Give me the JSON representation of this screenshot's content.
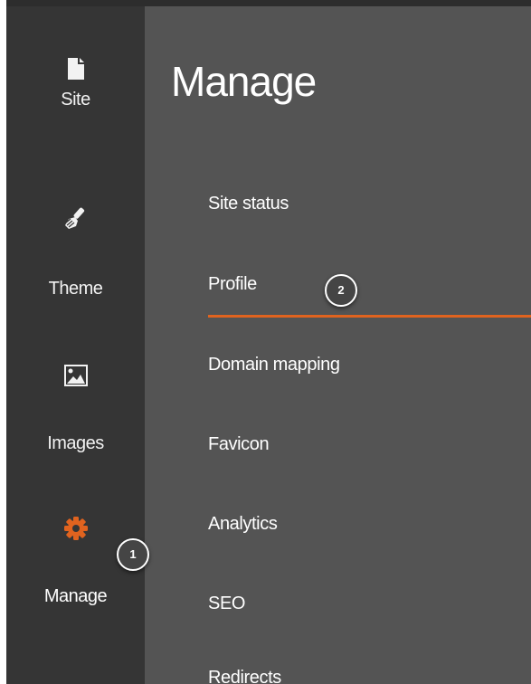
{
  "sidebar": {
    "items": [
      {
        "label": "Site",
        "icon": "document-icon"
      },
      {
        "label": "Theme",
        "icon": "paintbrush-icon"
      },
      {
        "label": "Images",
        "icon": "image-icon"
      },
      {
        "label": "Manage",
        "icon": "gear-icon",
        "active": true
      }
    ]
  },
  "main": {
    "title": "Manage",
    "menu": [
      {
        "label": "Site status"
      },
      {
        "label": "Profile",
        "selected": true
      },
      {
        "label": "Domain mapping"
      },
      {
        "label": "Favicon"
      },
      {
        "label": "Analytics"
      },
      {
        "label": "SEO"
      },
      {
        "label": "Redirects"
      }
    ]
  },
  "callouts": [
    "1",
    "2"
  ],
  "colors": {
    "sidebar_bg": "#353535",
    "main_bg": "#545454",
    "accent": "#e0631f",
    "text": "#ffffff"
  }
}
